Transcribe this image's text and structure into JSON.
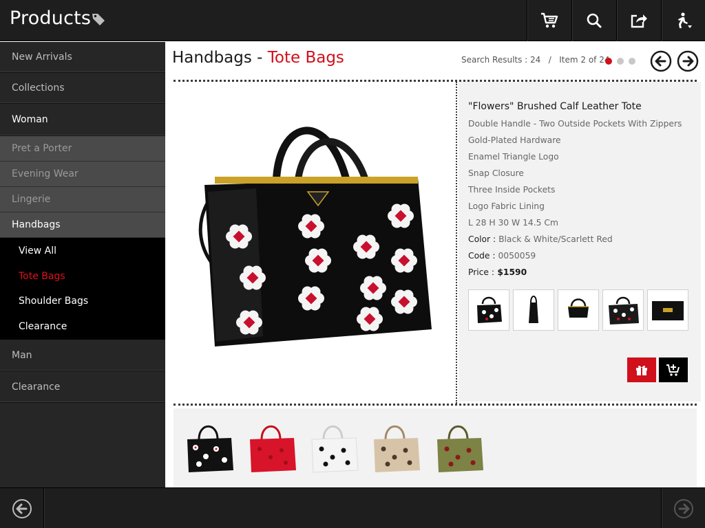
{
  "header": {
    "title": "Products",
    "icons": [
      "tag-icon",
      "cart-icon",
      "search-icon",
      "share-icon",
      "accessibility-icon"
    ]
  },
  "sidebar": {
    "items": [
      {
        "label": "New Arrivals"
      },
      {
        "label": "Collections"
      },
      {
        "label": "Woman"
      },
      {
        "label": "Pret a Porter"
      },
      {
        "label": "Evening Wear"
      },
      {
        "label": "Lingerie"
      },
      {
        "label": "Handbags"
      },
      {
        "label": "View All"
      },
      {
        "label": "Tote Bags"
      },
      {
        "label": "Shoulder Bags"
      },
      {
        "label": "Clearance"
      },
      {
        "label": "Man"
      },
      {
        "label": "Clearance"
      }
    ],
    "active": "Tote Bags"
  },
  "main": {
    "breadcrumb": {
      "category": "Handbags",
      "separator": " - ",
      "subcategory": "Tote Bags"
    },
    "results": "Search Results : 24   /   Item 2 of 24",
    "pager": {
      "count": 3,
      "active": 1
    }
  },
  "product": {
    "name": "\"Flowers\" Brushed Calf Leather Tote",
    "features": [
      "Double Handle - Two Outside Pockets With Zippers",
      "Gold-Plated Hardware",
      "Enamel Triangle Logo",
      "Snap Closure",
      "Three Inside Pockets",
      "Logo Fabric Lining",
      "L 28 H 30 W 14.5 Cm"
    ],
    "color_label": "Color :",
    "color_value": " Black & White/Scarlett Red",
    "code_label": "Code :",
    "code_value": " 0050059",
    "price_label": "Price :",
    "price_value": " $1590"
  },
  "colors": {
    "accent": "#d0101b",
    "header_bg": "#1e1e1e",
    "sidebar_bg": "#262626",
    "submenu_bg": "#4a4a4a",
    "leaf_bg": "#000000",
    "panel_bg": "#f2f2f2"
  },
  "variants": [
    "black-white",
    "red",
    "white",
    "beige",
    "olive"
  ]
}
